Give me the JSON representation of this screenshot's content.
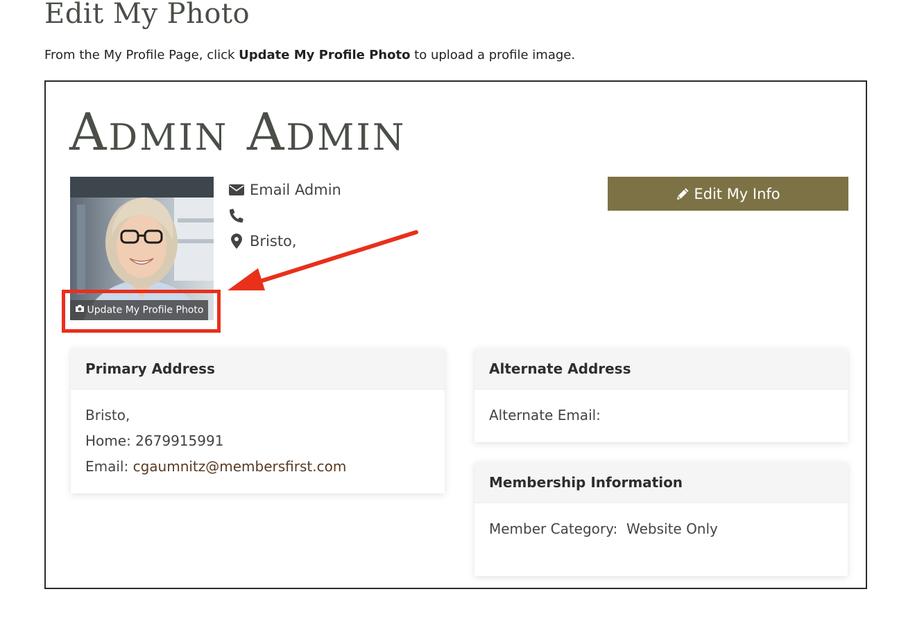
{
  "page": {
    "heading": "Edit My Photo",
    "intro_before": "From the My Profile Page, click ",
    "intro_bold": "Update My Profile Photo",
    "intro_after": " to upload a profile image."
  },
  "profile": {
    "name": "Admin Admin",
    "update_photo_label": "Update My Profile Photo",
    "contact": {
      "email_label": "Email Admin",
      "phone": "",
      "location": "Bristo,"
    },
    "edit_info_label": "Edit My Info"
  },
  "cards": {
    "primary": {
      "title": "Primary Address",
      "address": "Bristo,",
      "home_label": "Home: ",
      "home_value": "2679915991",
      "email_label": "Email: ",
      "email_value": "cgaumnitz@membersfirst.com"
    },
    "alternate": {
      "title": "Alternate Address",
      "alt_email_label": "Alternate Email: ",
      "alt_email_value": ""
    },
    "membership": {
      "title": "Membership Information",
      "category_label": "Member Category:  ",
      "category_value": "Website Only"
    }
  },
  "colors": {
    "accent_button": "#7d7245",
    "annotation_red": "#e8301b",
    "heading": "#4a4f47",
    "link": "#5a3b22"
  },
  "icons": [
    "envelope-icon",
    "phone-icon",
    "map-marker-icon",
    "pencil-icon",
    "camera-icon"
  ]
}
